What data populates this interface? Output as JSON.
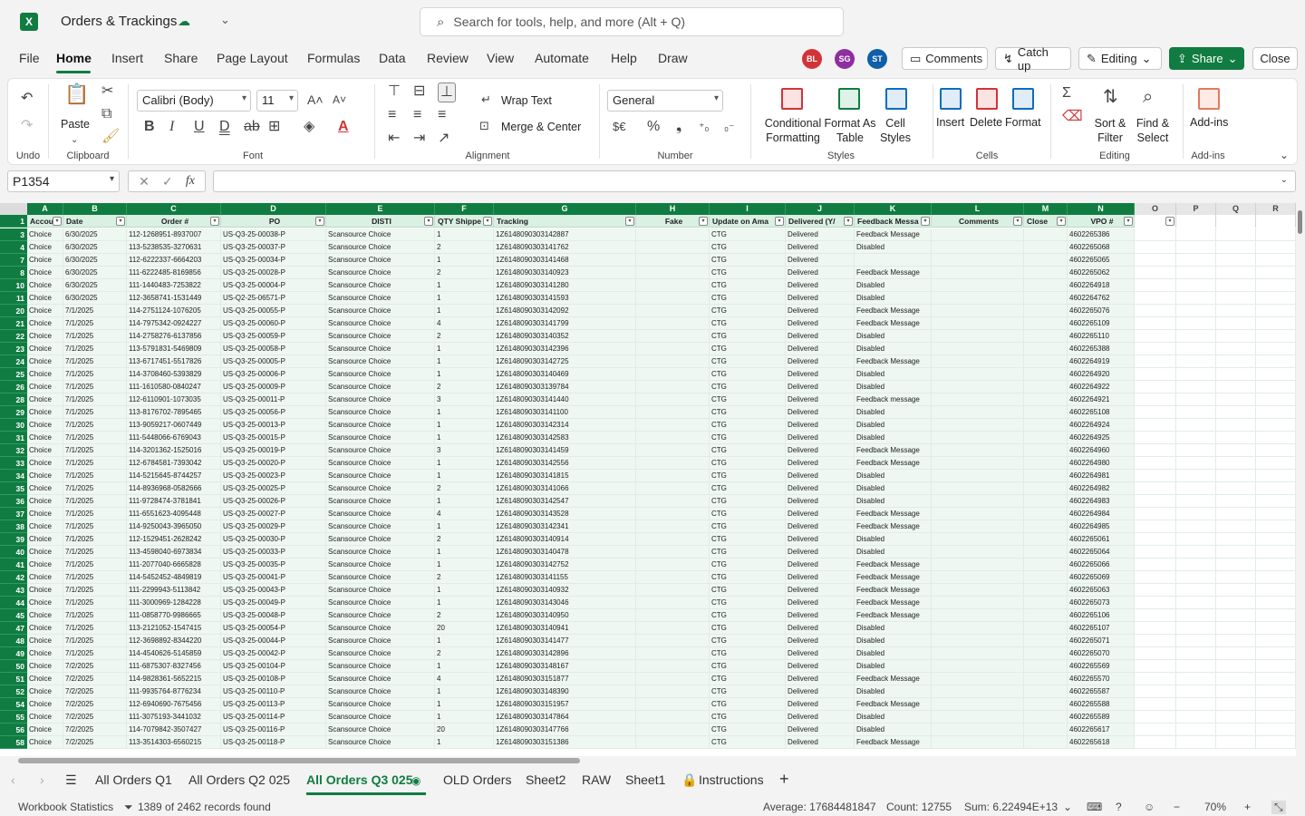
{
  "title": {
    "app_letter": "X",
    "document_name": "Orders & Trackings",
    "saved_icon": "cloud-saved-icon",
    "search_placeholder": "Search for tools, help, and more (Alt + Q)"
  },
  "menu": {
    "tabs": [
      "File",
      "Home",
      "Insert",
      "Share",
      "Page Layout",
      "Formulas",
      "Data",
      "Review",
      "View",
      "Automate",
      "Help",
      "Draw"
    ],
    "active": "Home"
  },
  "collaborators": [
    {
      "initials": "BL",
      "color": "#d13438"
    },
    {
      "initials": "SG",
      "color": "#8e2ea0"
    },
    {
      "initials": "ST",
      "color": "#0f5ea8"
    }
  ],
  "top_buttons": {
    "comments": "Comments",
    "catch_up": "Catch up",
    "editing": "Editing",
    "share": "Share",
    "close": "Close"
  },
  "ribbon": {
    "undo_label": "Undo",
    "clipboard_label": "Clipboard",
    "paste": "Paste",
    "font_label": "Font",
    "font_name": "Calibri (Body)",
    "font_size": "11",
    "alignment_label": "Alignment",
    "wrap_text": "Wrap Text",
    "merge_center": "Merge & Center",
    "number_label": "Number",
    "number_format": "General",
    "styles_label": "Styles",
    "conditional_formatting": "Conditional Formatting",
    "format_as_table": "Format As Table",
    "cell_styles": "Cell Styles",
    "cells_label": "Cells",
    "insert": "Insert",
    "delete": "Delete",
    "format": "Format",
    "editing_label": "Editing",
    "sort_filter": "Sort & Filter",
    "find_select": "Find & Select",
    "addins_label": "Add-ins",
    "addins": "Add-ins"
  },
  "formula_bar": {
    "name_box": "P1354",
    "fx": "fx",
    "value": ""
  },
  "sheet": {
    "column_letters": [
      "A",
      "B",
      "C",
      "D",
      "E",
      "F",
      "G",
      "H",
      "I",
      "J",
      "K",
      "L",
      "M",
      "N",
      "O",
      "P",
      "Q",
      "R"
    ],
    "header_row_number": "1",
    "headers": [
      "Accou",
      "Date",
      "Order #",
      "PO",
      "DISTI",
      "QTY Shippe",
      "Tracking",
      "Fake",
      "Update on Ama",
      "Delivered (Y/",
      "Feedback Messa",
      "Comments",
      "Close",
      "VPO #",
      "",
      "",
      "",
      ""
    ],
    "rows": [
      [
        "3",
        "Choice",
        "6/30/2025",
        "112-1268951-8937007",
        "US-Q3-25-00038-P",
        "Scansource Choice",
        "1",
        "1Z6148090303142887",
        "",
        "CTG",
        "Delivered",
        "Feedback Message",
        "",
        "",
        "4602265386"
      ],
      [
        "4",
        "Choice",
        "6/30/2025",
        "113-5238535-3270631",
        "US-Q3-25-00037-P",
        "Scansource Choice",
        "2",
        "1Z6148090303141762",
        "",
        "CTG",
        "Delivered",
        "Disabled",
        "",
        "",
        "4602265068"
      ],
      [
        "7",
        "Choice",
        "6/30/2025",
        "112-6222337-6664203",
        "US-Q3-25-00034-P",
        "Scansource Choice",
        "1",
        "1Z6148090303141468",
        "",
        "CTG",
        "Delivered",
        "",
        "",
        "",
        "4602265065"
      ],
      [
        "8",
        "Choice",
        "6/30/2025",
        "111-6222485-8169856",
        "US-Q3-25-00028-P",
        "Scansource Choice",
        "2",
        "1Z6148090303140923",
        "",
        "CTG",
        "Delivered",
        "Feedback Message",
        "",
        "",
        "4602265062"
      ],
      [
        "10",
        "Choice",
        "6/30/2025",
        "111-1440483-7253822",
        "US-Q3-25-00004-P",
        "Scansource Choice",
        "1",
        "1Z6148090303141280",
        "",
        "CTG",
        "Delivered",
        "Disabled",
        "",
        "",
        "4602264918"
      ],
      [
        "11",
        "Choice",
        "6/30/2025",
        "112-3658741-1531449",
        "US-Q2-25-06571-P",
        "Scansource Choice",
        "1",
        "1Z6148090303141593",
        "",
        "CTG",
        "Delivered",
        "Disabled",
        "",
        "",
        "4602264762"
      ],
      [
        "20",
        "Choice",
        "7/1/2025",
        "114-2751124-1076205",
        "US-Q3-25-00055-P",
        "Scansource Choice",
        "1",
        "1Z6148090303142092",
        "",
        "CTG",
        "Delivered",
        "Feedback Message",
        "",
        "",
        "4602265076"
      ],
      [
        "21",
        "Choice",
        "7/1/2025",
        "114-7975342-0924227",
        "US-Q3-25-00060-P",
        "Scansource Choice",
        "4",
        "1Z6148090303141799",
        "",
        "CTG",
        "Delivered",
        "Feedback Message",
        "",
        "",
        "4602265109"
      ],
      [
        "22",
        "Choice",
        "7/1/2025",
        "114-2758276-6137856",
        "US-Q3-25-00059-P",
        "Scansource Choice",
        "2",
        "1Z6148090303140352",
        "",
        "CTG",
        "Delivered",
        "Disabled",
        "",
        "",
        "4602265110"
      ],
      [
        "23",
        "Choice",
        "7/1/2025",
        "113-5791831-5469809",
        "US-Q3-25-00058-P",
        "Scansource Choice",
        "1",
        "1Z6148090303142396",
        "",
        "CTG",
        "Delivered",
        "Disabled",
        "",
        "",
        "4602265388"
      ],
      [
        "24",
        "Choice",
        "7/1/2025",
        "113-6717451-5517826",
        "US-Q3-25-00005-P",
        "Scansource Choice",
        "1",
        "1Z6148090303142725",
        "",
        "CTG",
        "Delivered",
        "Feedback Message",
        "",
        "",
        "4602264919"
      ],
      [
        "25",
        "Choice",
        "7/1/2025",
        "114-3708460-5393829",
        "US-Q3-25-00006-P",
        "Scansource Choice",
        "1",
        "1Z6148090303140469",
        "",
        "CTG",
        "Delivered",
        "Disabled",
        "",
        "",
        "4602264920"
      ],
      [
        "26",
        "Choice",
        "7/1/2025",
        "111-1610580-0840247",
        "US-Q3-25-00009-P",
        "Scansource Choice",
        "2",
        "1Z6148090303139784",
        "",
        "CTG",
        "Delivered",
        "Disabled",
        "",
        "",
        "4602264922"
      ],
      [
        "28",
        "Choice",
        "7/1/2025",
        "112-6110901-1073035",
        "US-Q3-25-00011-P",
        "Scansource Choice",
        "3",
        "1Z6148090303141440",
        "",
        "CTG",
        "Delivered",
        "Feedback message",
        "",
        "",
        "4602264921"
      ],
      [
        "29",
        "Choice",
        "7/1/2025",
        "113-8176702-7895465",
        "US-Q3-25-00056-P",
        "Scansource Choice",
        "1",
        "1Z6148090303141100",
        "",
        "CTG",
        "Delivered",
        "Disabled",
        "",
        "",
        "4602265108"
      ],
      [
        "30",
        "Choice",
        "7/1/2025",
        "113-9059217-0607449",
        "US-Q3-25-00013-P",
        "Scansource Choice",
        "1",
        "1Z6148090303142314",
        "",
        "CTG",
        "Delivered",
        "Disabled",
        "",
        "",
        "4602264924"
      ],
      [
        "31",
        "Choice",
        "7/1/2025",
        "111-5448066-6769043",
        "US-Q3-25-00015-P",
        "Scansource Choice",
        "1",
        "1Z6148090303142583",
        "",
        "CTG",
        "Delivered",
        "Disabled",
        "",
        "",
        "4602264925"
      ],
      [
        "32",
        "Choice",
        "7/1/2025",
        "114-3201362-1525016",
        "US-Q3-25-00019-P",
        "Scansource Choice",
        "3",
        "1Z6148090303141459",
        "",
        "CTG",
        "Delivered",
        "Feedback Message",
        "",
        "",
        "4602264960"
      ],
      [
        "33",
        "Choice",
        "7/1/2025",
        "112-6784581-7393042",
        "US-Q3-25-00020-P",
        "Scansource Choice",
        "1",
        "1Z6148090303142556",
        "",
        "CTG",
        "Delivered",
        "Feedback Message",
        "",
        "",
        "4602264980"
      ],
      [
        "34",
        "Choice",
        "7/1/2025",
        "114-5215645-8744257",
        "US-Q3-25-00023-P",
        "Scansource Choice",
        "1",
        "1Z6148090303141815",
        "",
        "CTG",
        "Delivered",
        "Disabled",
        "",
        "",
        "4602264981"
      ],
      [
        "35",
        "Choice",
        "7/1/2025",
        "114-8936968-0582666",
        "US-Q3-25-00025-P",
        "Scansource Choice",
        "2",
        "1Z6148090303141066",
        "",
        "CTG",
        "Delivered",
        "Disabled",
        "",
        "",
        "4602264982"
      ],
      [
        "36",
        "Choice",
        "7/1/2025",
        "111-9728474-3781841",
        "US-Q3-25-00026-P",
        "Scansource Choice",
        "1",
        "1Z6148090303142547",
        "",
        "CTG",
        "Delivered",
        "Disabled",
        "",
        "",
        "4602264983"
      ],
      [
        "37",
        "Choice",
        "7/1/2025",
        "111-6551623-4095448",
        "US-Q3-25-00027-P",
        "Scansource Choice",
        "4",
        "1Z6148090303143528",
        "",
        "CTG",
        "Delivered",
        "Feedback Message",
        "",
        "",
        "4602264984"
      ],
      [
        "38",
        "Choice",
        "7/1/2025",
        "114-9250043-3965050",
        "US-Q3-25-00029-P",
        "Scansource Choice",
        "1",
        "1Z6148090303142341",
        "",
        "CTG",
        "Delivered",
        "Feedback Message",
        "",
        "",
        "4602264985"
      ],
      [
        "39",
        "Choice",
        "7/1/2025",
        "112-1529451-2628242",
        "US-Q3-25-00030-P",
        "Scansource Choice",
        "2",
        "1Z6148090303140914",
        "",
        "CTG",
        "Delivered",
        "Disabled",
        "",
        "",
        "4602265061"
      ],
      [
        "40",
        "Choice",
        "7/1/2025",
        "113-4598040-6973834",
        "US-Q3-25-00033-P",
        "Scansource Choice",
        "1",
        "1Z6148090303140478",
        "",
        "CTG",
        "Delivered",
        "Disabled",
        "",
        "",
        "4602265064"
      ],
      [
        "41",
        "Choice",
        "7/1/2025",
        "111-2077040-6665828",
        "US-Q3-25-00035-P",
        "Scansource Choice",
        "1",
        "1Z6148090303142752",
        "",
        "CTG",
        "Delivered",
        "Feedback Message",
        "",
        "",
        "4602265066"
      ],
      [
        "42",
        "Choice",
        "7/1/2025",
        "114-5452452-4849819",
        "US-Q3-25-00041-P",
        "Scansource Choice",
        "2",
        "1Z6148090303141155",
        "",
        "CTG",
        "Delivered",
        "Feedback Message",
        "",
        "",
        "4602265069"
      ],
      [
        "43",
        "Choice",
        "7/1/2025",
        "111-2299943-5113842",
        "US-Q3-25-00043-P",
        "Scansource Choice",
        "1",
        "1Z6148090303140932",
        "",
        "CTG",
        "Delivered",
        "Feedback Message",
        "",
        "",
        "4602265063"
      ],
      [
        "44",
        "Choice",
        "7/1/2025",
        "111-3000969-1284228",
        "US-Q3-25-00049-P",
        "Scansource Choice",
        "1",
        "1Z6148090303143046",
        "",
        "CTG",
        "Delivered",
        "Feedback Message",
        "",
        "",
        "4602265073"
      ],
      [
        "45",
        "Choice",
        "7/1/2025",
        "111-0858770-9986665",
        "US-Q3-25-00048-P",
        "Scansource Choice",
        "2",
        "1Z6148090303140950",
        "",
        "CTG",
        "Delivered",
        "Feedback Message",
        "",
        "",
        "4602265106"
      ],
      [
        "47",
        "Choice",
        "7/1/2025",
        "113-2121052-1547415",
        "US-Q3-25-00054-P",
        "Scansource Choice",
        "20",
        "1Z6148090303140941",
        "",
        "CTG",
        "Delivered",
        "Disabled",
        "",
        "",
        "4602265107"
      ],
      [
        "48",
        "Choice",
        "7/1/2025",
        "112-3698892-8344220",
        "US-Q3-25-00044-P",
        "Scansource Choice",
        "1",
        "1Z6148090303141477",
        "",
        "CTG",
        "Delivered",
        "Disabled",
        "",
        "",
        "4602265071"
      ],
      [
        "49",
        "Choice",
        "7/1/2025",
        "114-4540626-5145859",
        "US-Q3-25-00042-P",
        "Scansource Choice",
        "2",
        "1Z6148090303142896",
        "",
        "CTG",
        "Delivered",
        "Disabled",
        "",
        "",
        "4602265070"
      ],
      [
        "50",
        "Choice",
        "7/2/2025",
        "111-6875307-8327456",
        "US-Q3-25-00104-P",
        "Scansource Choice",
        "1",
        "1Z6148090303148167",
        "",
        "CTG",
        "Delivered",
        "Disabled",
        "",
        "",
        "4602265569"
      ],
      [
        "51",
        "Choice",
        "7/2/2025",
        "114-9828361-5652215",
        "US-Q3-25-00108-P",
        "Scansource Choice",
        "4",
        "1Z6148090303151877",
        "",
        "CTG",
        "Delivered",
        "Feedback Message",
        "",
        "",
        "4602265570"
      ],
      [
        "52",
        "Choice",
        "7/2/2025",
        "111-9935764-8776234",
        "US-Q3-25-00110-P",
        "Scansource Choice",
        "1",
        "1Z6148090303148390",
        "",
        "CTG",
        "Delivered",
        "Disabled",
        "",
        "",
        "4602265587"
      ],
      [
        "54",
        "Choice",
        "7/2/2025",
        "112-6940690-7675456",
        "US-Q3-25-00113-P",
        "Scansource Choice",
        "1",
        "1Z6148090303151957",
        "",
        "CTG",
        "Delivered",
        "Feedback Message",
        "",
        "",
        "4602265588"
      ],
      [
        "55",
        "Choice",
        "7/2/2025",
        "111-3075193-3441032",
        "US-Q3-25-00114-P",
        "Scansource Choice",
        "1",
        "1Z6148090303147864",
        "",
        "CTG",
        "Delivered",
        "Disabled",
        "",
        "",
        "4602265589"
      ],
      [
        "56",
        "Choice",
        "7/2/2025",
        "114-7079842-3507427",
        "US-Q3-25-00116-P",
        "Scansource Choice",
        "20",
        "1Z6148090303147766",
        "",
        "CTG",
        "Delivered",
        "Disabled",
        "",
        "",
        "4602265617"
      ],
      [
        "58",
        "Choice",
        "7/2/2025",
        "113-3514303-6560215",
        "US-Q3-25-00118-P",
        "Scansource Choice",
        "1",
        "1Z6148090303151386",
        "",
        "CTG",
        "Delivered",
        "Feedback Message",
        "",
        "",
        "4602265618"
      ]
    ]
  },
  "sheet_tabs": {
    "tabs": [
      "All Orders Q1",
      "All Orders Q2 025",
      "All Orders Q3 025",
      "OLD Orders",
      "Sheet2",
      "RAW",
      "Sheet1",
      "Instructions"
    ],
    "active": "All Orders Q3 025",
    "add": "+"
  },
  "status": {
    "workbook_statistics": "Workbook Statistics",
    "filter_info": "1389 of 2462 records found",
    "average": "Average: 17684481847",
    "count": "Count: 12755",
    "sum": "Sum: 6.22494E+13",
    "zoom": "70%"
  },
  "colors": {
    "accent": "#107c41",
    "header_fill": "#d9f0e3"
  }
}
